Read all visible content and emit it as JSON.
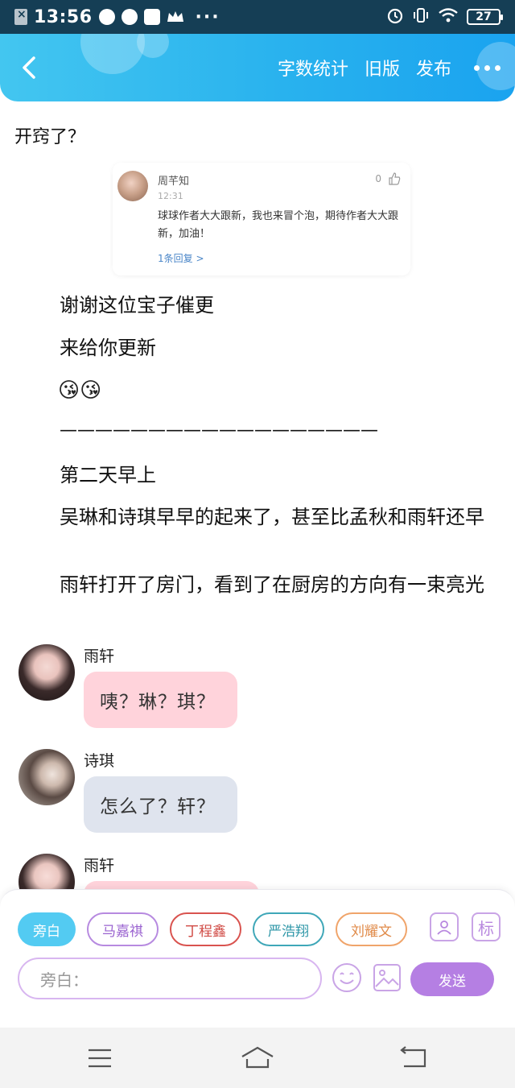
{
  "status_bar": {
    "time": "13:56",
    "battery": "27"
  },
  "header": {
    "back_label": "<",
    "action_wordcount": "字数统计",
    "action_oldversion": "旧版",
    "action_publish": "发布"
  },
  "content": {
    "line1": "开窍了？",
    "comment": {
      "name": "周芊知",
      "time": "12:31",
      "likes": "0",
      "text": "球球作者大大跟新，我也来冒个泡，期待作者大大跟新，加油！",
      "reply": "1条回复 >"
    },
    "thanks": "谢谢这位宝子催更",
    "update": "来给你更新",
    "emoji": "😘😘",
    "divider": "——————————————————",
    "next_day": "第二天早上",
    "para1": "吴琳和诗琪早早的起来了，甚至比孟秋和雨轩还早",
    "para2": "雨轩打开了房门，看到了在厨房的方向有一束亮光"
  },
  "chat": [
    {
      "name": "雨轩",
      "text": "咦？琳？琪？",
      "style": "pink"
    },
    {
      "name": "诗琪",
      "text": "怎么了？轩？",
      "style": "blue"
    },
    {
      "name": "雨轩",
      "text": "",
      "style": "pink"
    }
  ],
  "composer": {
    "chips": [
      "旁白",
      "马嘉祺",
      "丁程鑫",
      "严浩翔",
      "刘耀文"
    ],
    "tag_label": "标",
    "input_placeholder": "旁白：",
    "send_label": "发送"
  },
  "colors": {
    "header_start": "#43c6f0",
    "header_end": "#1aa3ef",
    "bubble_pink": "#ffd3db",
    "bubble_blue": "#dfe4ee",
    "send": "#b57fe3"
  }
}
